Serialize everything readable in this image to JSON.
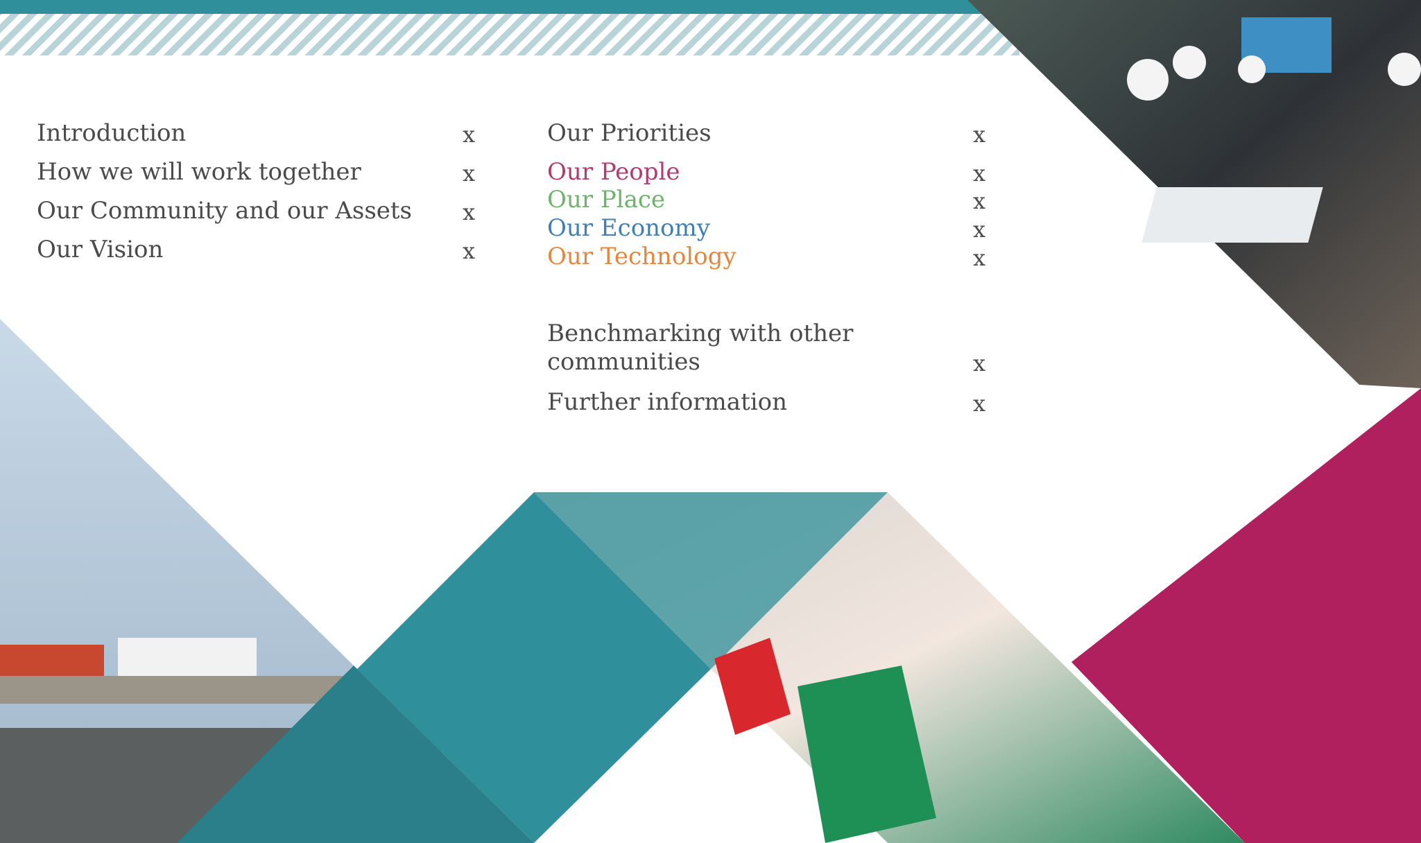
{
  "toc_left": [
    {
      "label": "Introduction",
      "marker": "x"
    },
    {
      "label": "How we will work together",
      "marker": "x"
    },
    {
      "label": "Our Community and our Assets",
      "marker": "x"
    },
    {
      "label": "Our Vision",
      "marker": "x"
    }
  ],
  "toc_right": {
    "priorities": {
      "label": "Our Priorities",
      "marker": "x"
    },
    "people": {
      "label": "Our People",
      "marker": "x"
    },
    "place": {
      "label": "Our Place",
      "marker": "x"
    },
    "economy": {
      "label": "Our Economy",
      "marker": "x"
    },
    "technology": {
      "label": "Our Technology",
      "marker": "x"
    },
    "benchmarking_line1": "Benchmarking with other",
    "benchmarking_line2": "communities",
    "benchmarking_marker": "x",
    "further": {
      "label": "Further information",
      "marker": "x"
    }
  },
  "colors": {
    "teal": "#2f8f9a",
    "magenta": "#b01f5e",
    "people": "#b23a6e",
    "place": "#6db36a",
    "economy": "#3f7fb8",
    "technology": "#e8853a"
  }
}
